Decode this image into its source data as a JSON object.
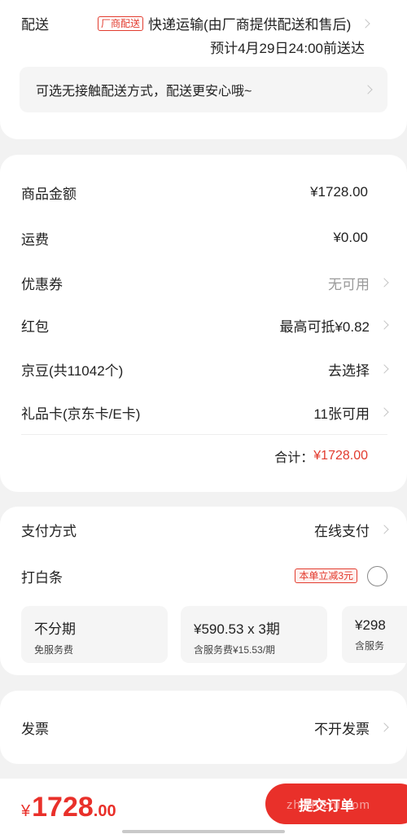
{
  "delivery": {
    "label": "配送",
    "tag": "厂商配送",
    "method": "快递运输(由厂商提供配送和售后)",
    "eta": "预计4月29日24:00前送达",
    "contactless": "可选无接触配送方式，配送更安心哦~"
  },
  "amounts": {
    "rows": [
      {
        "label": "商品金额",
        "value": "¥1728.00"
      },
      {
        "label": "运费",
        "value": "¥0.00"
      },
      {
        "label": "优惠券",
        "value": "无可用"
      },
      {
        "label": "红包",
        "value": "最高可抵¥0.82"
      },
      {
        "label": "京豆(共11042个)",
        "value": "去选择"
      },
      {
        "label": "礼品卡(京东卡/E卡)",
        "value": "11张可用"
      }
    ],
    "total_label": "合计：",
    "total_value": "¥1728.00"
  },
  "payment": {
    "label": "支付方式",
    "value": "在线支付",
    "baitiao_label": "打白条",
    "baitiao_promo": "本单立减3元",
    "installments": [
      {
        "title": "不分期",
        "sub": "免服务费"
      },
      {
        "title": "¥590.53 x 3期",
        "sub": "含服务费¥15.53/期"
      },
      {
        "title": "¥298",
        "sub": "含服务"
      }
    ]
  },
  "invoice": {
    "label": "发票",
    "value": "不开发票"
  },
  "footer": {
    "price_symbol": "¥",
    "price_int": "1728",
    "price_dec": ".00",
    "submit_label": "提交订单",
    "watermark": "zhizhizhi.com"
  },
  "colors": {
    "accent": "#e9302a",
    "text": "#222222",
    "muted": "#9a9a9a",
    "background": "#f2f2f2"
  }
}
